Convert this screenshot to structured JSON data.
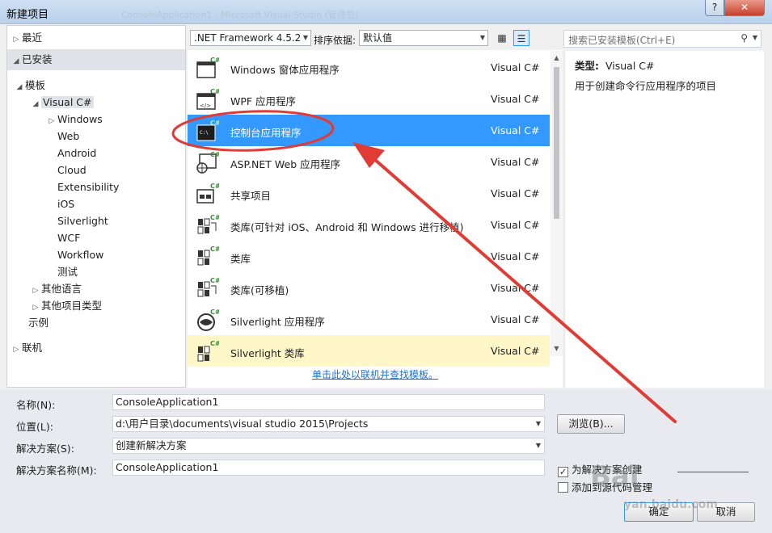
{
  "window": {
    "title": "新建项目",
    "background_title": "ConsoleApplication1 - Microsoft Visual Studio (管理员)",
    "help_label": "?",
    "close_label": "✕"
  },
  "tree": {
    "recent": "最近",
    "installed": "已安装",
    "templates": "模板",
    "visual_csharp": "Visual C#",
    "children": [
      "Windows",
      "Web",
      "Android",
      "Cloud",
      "Extensibility",
      "iOS",
      "Silverlight",
      "WCF",
      "Workflow",
      "测试"
    ],
    "other_languages": "其他语言",
    "other_project_types": "其他项目类型",
    "samples": "示例",
    "online": "联机"
  },
  "toolbar": {
    "framework": ".NET Framework 4.5.2",
    "sort_label": "排序依据:",
    "sort_value": "默认值",
    "search_placeholder": "搜索已安装模板(Ctrl+E)"
  },
  "templates": [
    {
      "name": "Windows 窗体应用程序",
      "lang": "Visual C#",
      "icon": "windows-forms-icon"
    },
    {
      "name": "WPF 应用程序",
      "lang": "Visual C#",
      "icon": "wpf-icon"
    },
    {
      "name": "控制台应用程序",
      "lang": "Visual C#",
      "icon": "console-icon"
    },
    {
      "name": "ASP.NET Web 应用程序",
      "lang": "Visual C#",
      "icon": "web-icon"
    },
    {
      "name": "共享项目",
      "lang": "Visual C#",
      "icon": "shared-project-icon"
    },
    {
      "name": "类库(可针对 iOS、Android 和 Windows 进行移植)",
      "lang": "Visual C#",
      "icon": "portable-library-icon"
    },
    {
      "name": "类库",
      "lang": "Visual C#",
      "icon": "class-library-icon"
    },
    {
      "name": "类库(可移植)",
      "lang": "Visual C#",
      "icon": "portable-class-library-icon"
    },
    {
      "name": "Silverlight 应用程序",
      "lang": "Visual C#",
      "icon": "silverlight-icon"
    },
    {
      "name": "Silverlight 类库",
      "lang": "Visual C#",
      "icon": "silverlight-library-icon"
    }
  ],
  "online_link": "单击此处以联机并查找模板。",
  "details": {
    "type_label": "类型:",
    "type_value": "Visual C#",
    "description": "用于创建命令行应用程序的项目"
  },
  "form": {
    "name_label": "名称(N):",
    "name_value": "ConsoleApplication1",
    "location_label": "位置(L):",
    "location_value": "d:\\用户目录\\documents\\visual studio 2015\\Projects",
    "solution_label": "解决方案(S):",
    "solution_value": "创建新解决方案",
    "solution_name_label": "解决方案名称(M):",
    "solution_name_value": "ConsoleApplication1",
    "browse_label": "浏览(B)...",
    "create_dir_label": "为解决方案创建",
    "create_dir_checked": true,
    "add_source_label": "添加到源代码管理",
    "add_source_checked": false,
    "ok_label": "确定",
    "cancel_label": "取消"
  },
  "watermark": {
    "logo": "Bai",
    "url": "yan.baidu.com"
  }
}
